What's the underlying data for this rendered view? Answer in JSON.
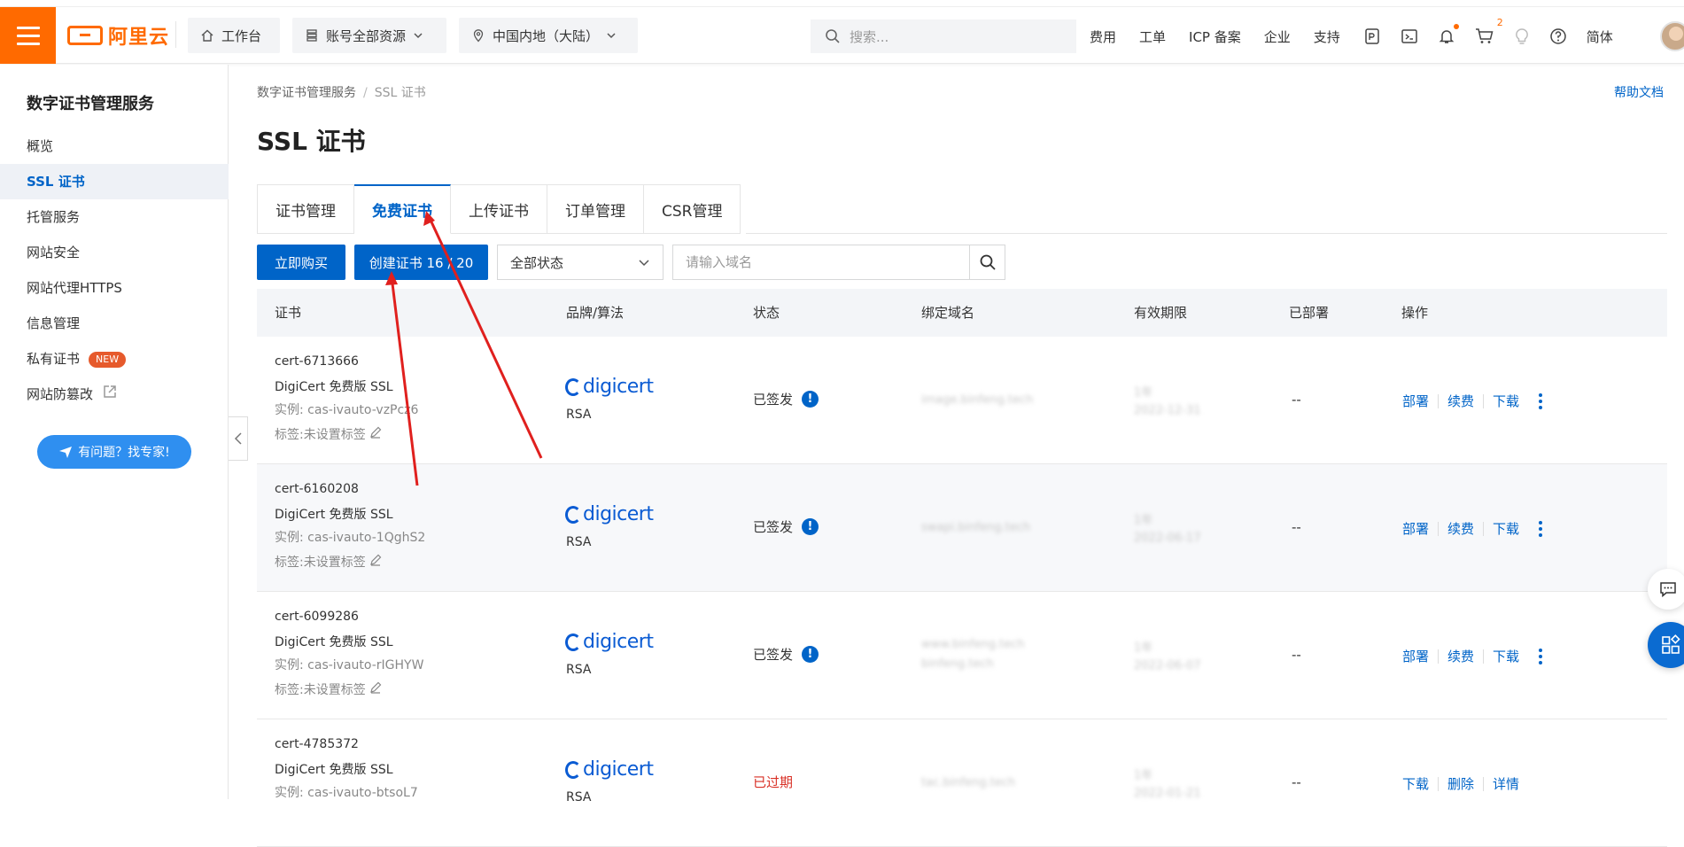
{
  "topbar": {
    "brand": "阿里云",
    "workbench": "工作台",
    "resources": "账号全部资源",
    "region": "中国内地（大陆）",
    "search_placeholder": "搜索...",
    "links": [
      "费用",
      "工单",
      "ICP 备案",
      "企业",
      "支持"
    ],
    "cart_count": "2",
    "language": "简体"
  },
  "sidebar": {
    "title": "数字证书管理服务",
    "items": [
      {
        "label": "概览"
      },
      {
        "label": "SSL 证书",
        "active": true
      },
      {
        "label": "托管服务"
      },
      {
        "label": "网站安全"
      },
      {
        "label": "网站代理HTTPS"
      },
      {
        "label": "信息管理"
      },
      {
        "label": "私有证书",
        "badge": "NEW"
      },
      {
        "label": "网站防篡改",
        "external": true
      }
    ],
    "ask_button": "有问题？找专家!"
  },
  "main": {
    "breadcrumb": [
      "数字证书管理服务",
      "SSL 证书"
    ],
    "help": "帮助文档",
    "title": "SSL 证书",
    "tabs": [
      "证书管理",
      "免费证书",
      "上传证书",
      "订单管理",
      "CSR管理"
    ],
    "active_tab": 1,
    "buy_button": "立即购买",
    "create_button": "创建证书 16 / 20",
    "status_select": "全部状态",
    "domain_placeholder": "请输入域名",
    "columns": [
      "证书",
      "品牌/算法",
      "状态",
      "绑定域名",
      "有效期限",
      "已部署",
      "操作"
    ],
    "rows": [
      {
        "id": "cert-6713666",
        "type": "DigiCert 免费版 SSL",
        "instance": "实例: cas-ivauto-vzPcz6",
        "tag": "标签:未设置标签",
        "brand": "digicert",
        "algorithm": "RSA",
        "status": "已签发",
        "domains": [
          "image.binfeng.tech"
        ],
        "validity": [
          "1年",
          "2022-12-31"
        ],
        "deployed": "--",
        "ops": [
          "部署",
          "续费",
          "下载"
        ]
      },
      {
        "id": "cert-6160208",
        "type": "DigiCert 免费版 SSL",
        "instance": "实例: cas-ivauto-1QghS2",
        "tag": "标签:未设置标签",
        "brand": "digicert",
        "algorithm": "RSA",
        "status": "已签发",
        "domains": [
          "swapi.binfeng.tech"
        ],
        "validity": [
          "1年",
          "2022-06-17"
        ],
        "deployed": "--",
        "ops": [
          "部署",
          "续费",
          "下载"
        ]
      },
      {
        "id": "cert-6099286",
        "type": "DigiCert 免费版 SSL",
        "instance": "实例: cas-ivauto-rIGHYW",
        "tag": "标签:未设置标签",
        "brand": "digicert",
        "algorithm": "RSA",
        "status": "已签发",
        "domains": [
          "www.binfeng.tech",
          "binfeng.tech"
        ],
        "validity": [
          "1年",
          "2022-06-07"
        ],
        "deployed": "--",
        "ops": [
          "部署",
          "续费",
          "下载"
        ]
      },
      {
        "id": "cert-4785372",
        "type": "DigiCert 免费版 SSL",
        "instance": "实例: cas-ivauto-btsoL7",
        "tag": "",
        "brand": "digicert",
        "algorithm": "RSA",
        "status": "已过期",
        "domains": [
          "tac.binfeng.tech"
        ],
        "validity": [
          "1年",
          "2022-01-21"
        ],
        "deployed": "--",
        "ops": [
          "下载",
          "删除",
          "详情"
        ]
      }
    ]
  },
  "colors": {
    "brand_orange": "#ff6a00",
    "primary_blue": "#0064c8",
    "expired_red": "#d93026",
    "annotation_red": "#e0201e"
  }
}
